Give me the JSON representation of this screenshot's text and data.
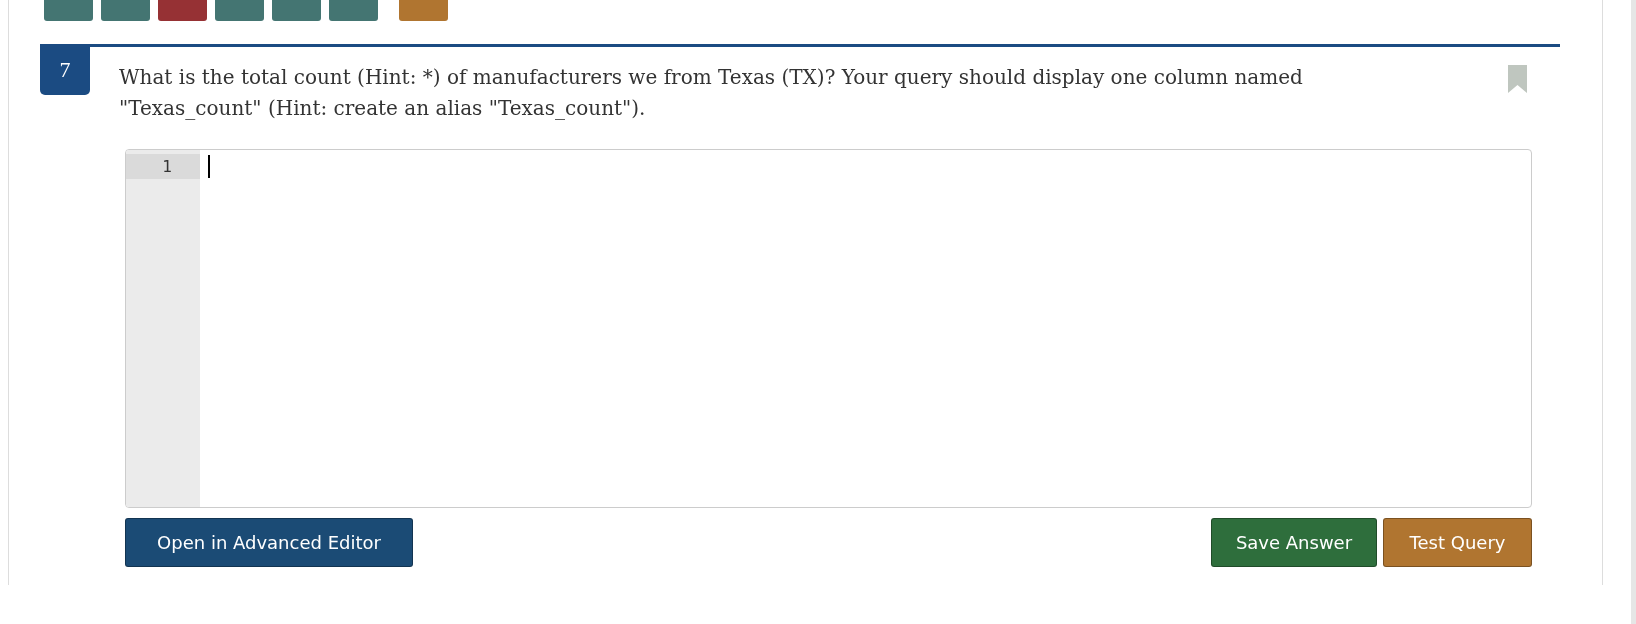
{
  "pagination": [
    {
      "color": "#447572"
    },
    {
      "color": "#447572"
    },
    {
      "color": "#963134"
    },
    {
      "color": "#447572"
    },
    {
      "color": "#447572"
    },
    {
      "color": "#447572"
    },
    {
      "color": "#b07530"
    }
  ],
  "question": {
    "number": "7",
    "text": "What is the total count (Hint: *) of manufacturers we from Texas (TX)? Your query should display one column named \"Texas_count\" (Hint: create an alias \"Texas_count\").",
    "bookmarked": false
  },
  "editor": {
    "line_numbers": [
      "1"
    ]
  },
  "buttons": {
    "left": "Open in Advanced Editor",
    "right": [
      {
        "label": "Save Answer",
        "kind": "save"
      },
      {
        "label": "Test Query",
        "kind": "test"
      }
    ]
  }
}
